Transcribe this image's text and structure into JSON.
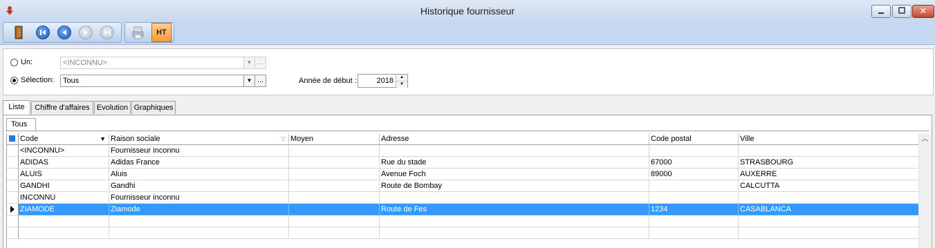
{
  "window": {
    "title": "Historique fournisseur",
    "close_glyph": "✕"
  },
  "toolbar": {
    "ht_label": "HT"
  },
  "filter": {
    "un_label": "Un:",
    "un_value": "<INCONNU>",
    "selection_label": "Sélection:",
    "selection_value": "Tous",
    "ellipsis": "...",
    "start_year_label": "Année de début :",
    "start_year_value": "2018",
    "selected_mode": "selection"
  },
  "tabs": [
    {
      "label": "Liste",
      "active": true
    },
    {
      "label": "Chiffre d'affaires",
      "active": false
    },
    {
      "label": "Evolution",
      "active": false
    },
    {
      "label": "Graphiques",
      "active": false
    }
  ],
  "subtab": "Tous",
  "grid": {
    "columns": [
      "Code",
      "Raison sociale",
      "Moyen",
      "Adresse",
      "Code postal",
      "Ville"
    ],
    "rows": [
      [
        "<INCONNU>",
        "Fournisseur inconnu",
        "",
        "",
        "",
        ""
      ],
      [
        "ADIDAS",
        "Adidas France",
        "",
        "Rue du stade",
        "67000",
        "STRASBOURG"
      ],
      [
        "ALUIS",
        "Aluis",
        "",
        "Avenue Foch",
        "89000",
        "AUXERRE"
      ],
      [
        "GANDHI",
        "Gandhi",
        "",
        "Route de Bombay",
        "",
        "CALCUTTA"
      ],
      [
        "INCONNU",
        "Fournisseur inconnu",
        "",
        "",
        "",
        ""
      ],
      [
        "ZIAMODE",
        "Ziamode",
        "",
        "Route de Fes",
        "1234",
        "CASABLANCA"
      ]
    ],
    "selected_row": 5,
    "empty_rows": 2
  },
  "colors": {
    "selection": "#3399ff",
    "toolbar": "#c7d9f2",
    "ht_button": "#f79a3a"
  }
}
